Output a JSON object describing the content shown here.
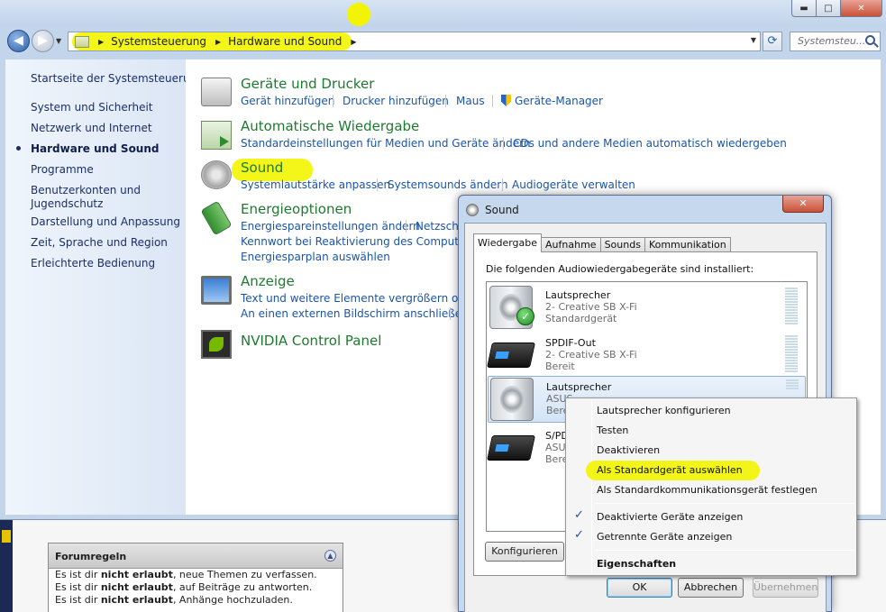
{
  "forum": {
    "title": "Forumregeln",
    "lines": [
      {
        "pre": "Es ist dir ",
        "bold": "nicht erlaubt",
        "post": ", neue Themen zu verfassen."
      },
      {
        "pre": "Es ist dir ",
        "bold": "nicht erlaubt",
        "post": ", auf Beiträge zu antworten."
      },
      {
        "pre": "Es ist dir ",
        "bold": "nicht erlaubt",
        "post": ", Anhänge hochzuladen."
      }
    ]
  },
  "window": {
    "controls": {
      "minimize": "▬",
      "maximize": "□",
      "close": "✕"
    }
  },
  "address": {
    "crumbs": [
      "Systemsteuerung",
      "Hardware und Sound"
    ],
    "search_placeholder": "Systemsteu..."
  },
  "sidebar": {
    "home": "Startseite der Systemsteuerung",
    "items": [
      {
        "label": "System und Sicherheit",
        "active": false
      },
      {
        "label": "Netzwerk und Internet",
        "active": false
      },
      {
        "label": "Hardware und Sound",
        "active": true
      },
      {
        "label": "Programme",
        "active": false
      },
      {
        "label": "Benutzerkonten und",
        "active": false
      },
      {
        "label": "Jugendschutz",
        "active": false
      },
      {
        "label": "Darstellung und Anpassung",
        "active": false
      },
      {
        "label": "Zeit, Sprache und Region",
        "active": false
      },
      {
        "label": "Erleichterte Bedienung",
        "active": false
      }
    ]
  },
  "categories": {
    "devices": {
      "title": "Geräte und Drucker",
      "links": [
        "Gerät hinzufügen",
        "Drucker hinzufügen",
        "Maus",
        "Geräte-Manager"
      ]
    },
    "autoplay": {
      "title": "Automatische Wiedergabe",
      "links": [
        "Standardeinstellungen für Medien und Geräte ändern",
        "CDs und andere Medien automatisch wiedergeben"
      ]
    },
    "sound": {
      "title": "Sound",
      "links": [
        "Systemlautstärke anpassen",
        "Systemsounds ändern",
        "Audiogeräte verwalten"
      ]
    },
    "power": {
      "title": "Energieoptionen",
      "links": [
        "Energiespareinstellungen ändern",
        "Netzscha",
        "Kennwort bei Reaktivierung des Computers an",
        "Energiesparplan auswählen"
      ]
    },
    "display": {
      "title": "Anzeige",
      "links": [
        "Text und weitere Elemente vergrößern oder ve",
        "An einen externen Bildschirm anschließen"
      ]
    },
    "nvidia": {
      "title": "NVIDIA Control Panel"
    }
  },
  "sound_dialog": {
    "title": "Sound",
    "close": "✕",
    "tabs": [
      "Wiedergabe",
      "Aufnahme",
      "Sounds",
      "Kommunikation"
    ],
    "instruction": "Die folgenden Audiowiedergabegeräte sind installiert:",
    "devices": [
      {
        "name": "Lautsprecher",
        "sub": "2- Creative SB X-Fi",
        "status": "Standardgerät",
        "icon": "speaker-icon"
      },
      {
        "name": "SPDIF-Out",
        "sub": "2- Creative SB X-Fi",
        "status": "Bereit",
        "icon": "spdif-device-icon"
      },
      {
        "name": "Lautsprecher",
        "sub": "ASUS",
        "status": "Bere",
        "icon": "speaker-icon"
      },
      {
        "name": "S/PD",
        "sub": "ASUS",
        "status": "Bere",
        "icon": "spdif-device-icon"
      }
    ],
    "configure": "Konfigurieren",
    "ok": "OK",
    "cancel": "Abbrechen",
    "apply": "Übernehmen"
  },
  "context_menu": {
    "items": [
      "Lautsprecher konfigurieren",
      "Testen",
      "Deaktivieren",
      "Als Standardgerät auswählen",
      "Als Standardkommunikationsgerät festlegen"
    ],
    "checks": [
      "Deaktivierte Geräte anzeigen",
      "Getrennte Geräte anzeigen"
    ],
    "properties": "Eigenschaften"
  },
  "colors": {
    "highlight": "#f3f500",
    "link": "#1b55a8",
    "category_title": "#1e7a2e"
  }
}
